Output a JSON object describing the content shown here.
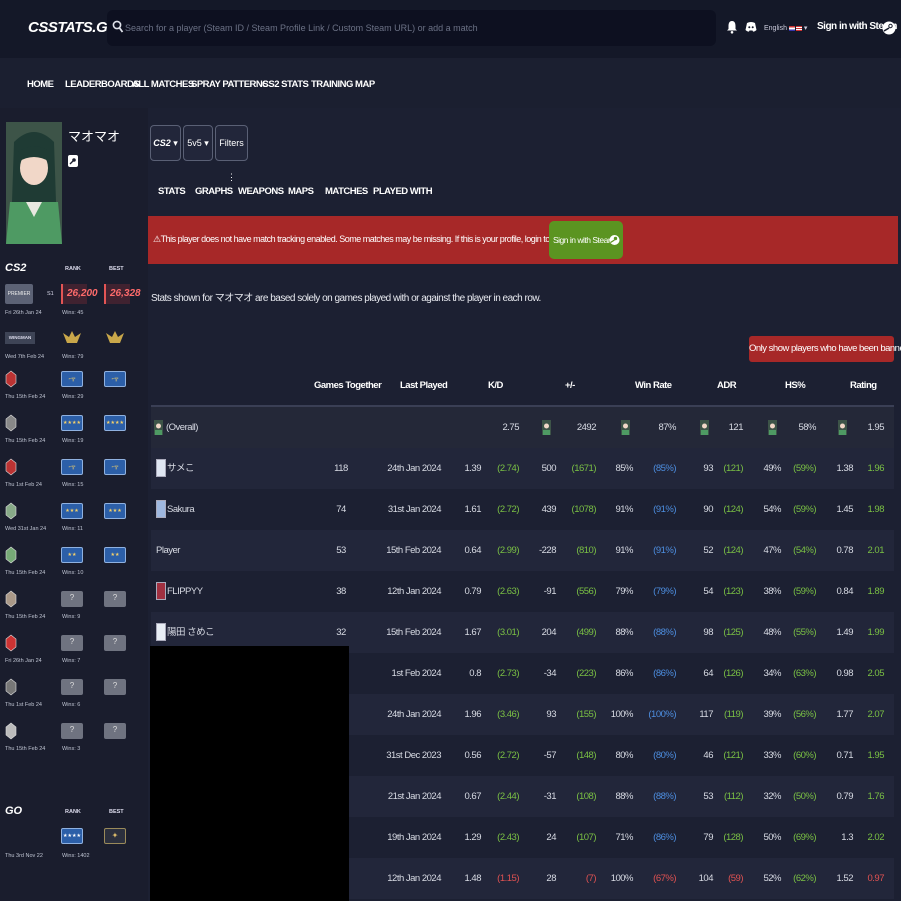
{
  "header": {
    "logo": "CSSTATS.GG",
    "search_placeholder": "Search for a player (Steam ID / Steam Profile Link / Custom Steam URL) or add a match",
    "language": "English",
    "signin": "Sign in with Steam"
  },
  "nav": [
    "HOME",
    "LEADERBOARDS",
    "ALL MATCHES",
    "SPRAY PATTERNS",
    "CS2 STATS",
    "TRAINING MAP"
  ],
  "profile": {
    "name": "マオマオ"
  },
  "sidebar": {
    "cs2_logo": "CS2",
    "go_logo": "GO",
    "rank_label": "RANK",
    "best_label": "BEST",
    "premier": {
      "label": "PREMIER",
      "season": "S1",
      "rank": "26,200",
      "best": "26,328",
      "date": "Fri 26th Jan 24",
      "wins": "Wins: 45"
    },
    "wingman": {
      "label": "WINGMAN",
      "date": "Wed 7th Feb 24",
      "wins": "Wins: 79"
    },
    "maps": [
      {
        "date": "Thu 15th Feb 24",
        "wins": "Wins: 29",
        "rank": "ak",
        "best": "ak"
      },
      {
        "date": "Thu 15th Feb 24",
        "wins": "Wins: 19",
        "rank": "stars4",
        "best": "stars4"
      },
      {
        "date": "Thu 1st Feb 24",
        "wins": "Wins: 15",
        "rank": "ak",
        "best": "ak"
      },
      {
        "date": "Wed 31st Jan 24",
        "wins": "Wins: 11",
        "rank": "stars3",
        "best": "stars3"
      },
      {
        "date": "Thu 15th Feb 24",
        "wins": "Wins: 10",
        "rank": "stars2",
        "best": "stars2"
      },
      {
        "date": "Thu 15th Feb 24",
        "wins": "Wins: 9",
        "rank": "?",
        "best": "?"
      },
      {
        "date": "Fri 26th Jan 24",
        "wins": "Wins: 7",
        "rank": "?",
        "best": "?"
      },
      {
        "date": "Thu 1st Feb 24",
        "wins": "Wins: 6",
        "rank": "?",
        "best": "?"
      },
      {
        "date": "Thu 15th Feb 24",
        "wins": "Wins: 3",
        "rank": "?",
        "best": "?"
      }
    ],
    "go": {
      "date": "Thu 3rd Nov 22",
      "wins": "Wins: 1402"
    }
  },
  "filters": {
    "game": "CS2",
    "mode": "5v5",
    "filters": "Filters"
  },
  "subtabs": [
    "STATS",
    "GRAPHS",
    "WEAPONS",
    "MAPS",
    "MATCHES",
    "PLAYED WITH"
  ],
  "alert": {
    "text": "This player does not have match tracking enabled. Some matches may be missing. If this is your profile, login to set this up",
    "button": "Sign in with Steam"
  },
  "note": "Stats shown for マオマオ are based solely on games played with or against the player in each row.",
  "banned_button": "Only show players who have been banned",
  "table": {
    "headers": [
      "Games Together",
      "Last Played",
      "K/D",
      "+/-",
      "Win Rate",
      "ADR",
      "HS%",
      "Rating"
    ],
    "overall": {
      "name": "(Overall)",
      "kd": "2.75",
      "pm": "2492",
      "wr": "87%",
      "adr": "121",
      "hs": "58%",
      "rating": "1.95"
    },
    "rows": [
      {
        "name": "サメこ",
        "games": "118",
        "last": "24th Jan 2024",
        "kd": "1.39",
        "kd2": "(2.74)",
        "pm": "500",
        "pm2": "(1671)",
        "wr": "85%",
        "wr2": "(85%)",
        "adr": "93",
        "adr2": "(121)",
        "hs": "49%",
        "hs2": "(59%)",
        "rt": "1.38",
        "rt2": "1.96"
      },
      {
        "name": "Sakura",
        "games": "74",
        "last": "31st Jan 2024",
        "kd": "1.61",
        "kd2": "(2.72)",
        "pm": "439",
        "pm2": "(1078)",
        "wr": "91%",
        "wr2": "(91%)",
        "adr": "90",
        "adr2": "(124)",
        "hs": "54%",
        "hs2": "(59%)",
        "rt": "1.45",
        "rt2": "1.98"
      },
      {
        "name": "Player",
        "games": "53",
        "last": "15th Feb 2024",
        "kd": "0.64",
        "kd2": "(2.99)",
        "pm": "-228",
        "pm2": "(810)",
        "wr": "91%",
        "wr2": "(91%)",
        "adr": "52",
        "adr2": "(124)",
        "hs": "47%",
        "hs2": "(54%)",
        "rt": "0.78",
        "rt2": "2.01"
      },
      {
        "name": "FLIPPYY",
        "games": "38",
        "last": "12th Jan 2024",
        "kd": "0.79",
        "kd2": "(2.63)",
        "pm": "-91",
        "pm2": "(556)",
        "wr": "79%",
        "wr2": "(79%)",
        "adr": "54",
        "adr2": "(123)",
        "hs": "38%",
        "hs2": "(59%)",
        "rt": "0.84",
        "rt2": "1.89"
      },
      {
        "name": "陽田 さめこ",
        "games": "32",
        "last": "15th Feb 2024",
        "kd": "1.67",
        "kd2": "(3.01)",
        "pm": "204",
        "pm2": "(499)",
        "wr": "88%",
        "wr2": "(88%)",
        "adr": "98",
        "adr2": "(125)",
        "hs": "48%",
        "hs2": "(55%)",
        "rt": "1.49",
        "rt2": "1.99"
      },
      {
        "name": "",
        "games": "",
        "last": "1st Feb 2024",
        "kd": "0.8",
        "kd2": "(2.73)",
        "pm": "-34",
        "pm2": "(223)",
        "wr": "86%",
        "wr2": "(86%)",
        "adr": "64",
        "adr2": "(126)",
        "hs": "34%",
        "hs2": "(63%)",
        "rt": "0.98",
        "rt2": "2.05"
      },
      {
        "name": "",
        "games": "",
        "last": "24th Jan 2024",
        "kd": "1.96",
        "kd2": "(3.46)",
        "pm": "93",
        "pm2": "(155)",
        "wr": "100%",
        "wr2": "(100%)",
        "adr": "117",
        "adr2": "(119)",
        "hs": "39%",
        "hs2": "(56%)",
        "rt": "1.77",
        "rt2": "2.07"
      },
      {
        "name": "",
        "games": "",
        "last": "31st Dec 2023",
        "kd": "0.56",
        "kd2": "(2.72)",
        "pm": "-57",
        "pm2": "(148)",
        "wr": "80%",
        "wr2": "(80%)",
        "adr": "46",
        "adr2": "(121)",
        "hs": "33%",
        "hs2": "(60%)",
        "rt": "0.71",
        "rt2": "1.95"
      },
      {
        "name": "",
        "games": "",
        "last": "21st Jan 2024",
        "kd": "0.67",
        "kd2": "(2.44)",
        "pm": "-31",
        "pm2": "(108)",
        "wr": "88%",
        "wr2": "(88%)",
        "adr": "53",
        "adr2": "(112)",
        "hs": "32%",
        "hs2": "(50%)",
        "rt": "0.79",
        "rt2": "1.76"
      },
      {
        "name": "",
        "games": "",
        "last": "19th Jan 2024",
        "kd": "1.29",
        "kd2": "(2.43)",
        "pm": "24",
        "pm2": "(107)",
        "wr": "71%",
        "wr2": "(86%)",
        "adr": "79",
        "adr2": "(128)",
        "hs": "50%",
        "hs2": "(69%)",
        "rt": "1.3",
        "rt2": "2.02"
      },
      {
        "name": "",
        "games": "",
        "last": "12th Jan 2024",
        "kd": "1.48",
        "kd2": "(1.15)",
        "pm": "28",
        "pm2": "(7)",
        "wr": "100%",
        "wr2": "(67%)",
        "adr": "104",
        "adr2": "(59)",
        "hs": "52%",
        "hs2": "(62%)",
        "rt": "1.52",
        "rt2": "0.97",
        "bad": true
      }
    ]
  }
}
